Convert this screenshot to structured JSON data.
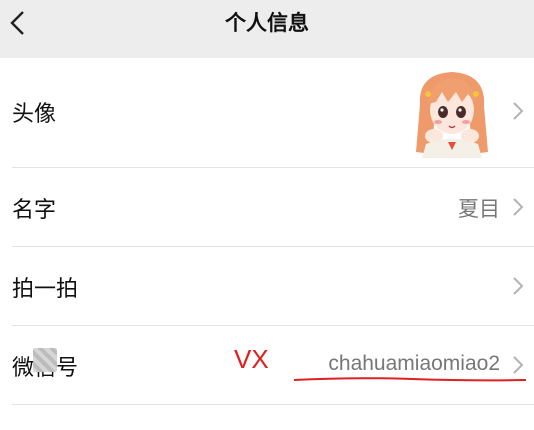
{
  "header": {
    "title": "个人信息"
  },
  "rows": [
    {
      "label": "头像",
      "value": ""
    },
    {
      "label": "名字",
      "value": "夏目"
    },
    {
      "label": "拍一拍",
      "value": ""
    },
    {
      "label": "微信号",
      "value": "chahuamiaomiao2"
    }
  ],
  "annotation": {
    "vx_text": "VX",
    "color": "#e02020"
  },
  "icons": [
    "back-arrow-icon",
    "chevron-right-icon"
  ]
}
